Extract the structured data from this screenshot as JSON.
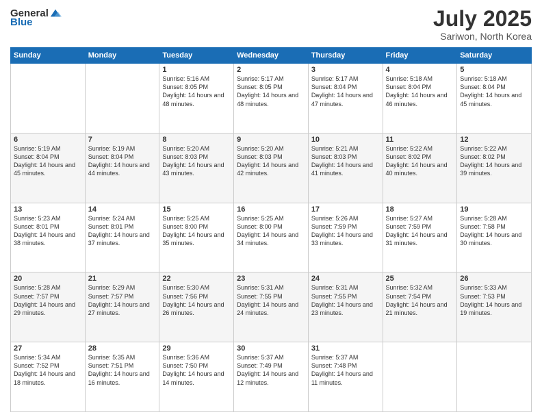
{
  "logo": {
    "general": "General",
    "blue": "Blue"
  },
  "title": "July 2025",
  "subtitle": "Sariwon, North Korea",
  "headers": [
    "Sunday",
    "Monday",
    "Tuesday",
    "Wednesday",
    "Thursday",
    "Friday",
    "Saturday"
  ],
  "weeks": [
    [
      {
        "day": "",
        "text": ""
      },
      {
        "day": "",
        "text": ""
      },
      {
        "day": "1",
        "text": "Sunrise: 5:16 AM\nSunset: 8:05 PM\nDaylight: 14 hours and 48 minutes."
      },
      {
        "day": "2",
        "text": "Sunrise: 5:17 AM\nSunset: 8:05 PM\nDaylight: 14 hours and 48 minutes."
      },
      {
        "day": "3",
        "text": "Sunrise: 5:17 AM\nSunset: 8:04 PM\nDaylight: 14 hours and 47 minutes."
      },
      {
        "day": "4",
        "text": "Sunrise: 5:18 AM\nSunset: 8:04 PM\nDaylight: 14 hours and 46 minutes."
      },
      {
        "day": "5",
        "text": "Sunrise: 5:18 AM\nSunset: 8:04 PM\nDaylight: 14 hours and 45 minutes."
      }
    ],
    [
      {
        "day": "6",
        "text": "Sunrise: 5:19 AM\nSunset: 8:04 PM\nDaylight: 14 hours and 45 minutes."
      },
      {
        "day": "7",
        "text": "Sunrise: 5:19 AM\nSunset: 8:04 PM\nDaylight: 14 hours and 44 minutes."
      },
      {
        "day": "8",
        "text": "Sunrise: 5:20 AM\nSunset: 8:03 PM\nDaylight: 14 hours and 43 minutes."
      },
      {
        "day": "9",
        "text": "Sunrise: 5:20 AM\nSunset: 8:03 PM\nDaylight: 14 hours and 42 minutes."
      },
      {
        "day": "10",
        "text": "Sunrise: 5:21 AM\nSunset: 8:03 PM\nDaylight: 14 hours and 41 minutes."
      },
      {
        "day": "11",
        "text": "Sunrise: 5:22 AM\nSunset: 8:02 PM\nDaylight: 14 hours and 40 minutes."
      },
      {
        "day": "12",
        "text": "Sunrise: 5:22 AM\nSunset: 8:02 PM\nDaylight: 14 hours and 39 minutes."
      }
    ],
    [
      {
        "day": "13",
        "text": "Sunrise: 5:23 AM\nSunset: 8:01 PM\nDaylight: 14 hours and 38 minutes."
      },
      {
        "day": "14",
        "text": "Sunrise: 5:24 AM\nSunset: 8:01 PM\nDaylight: 14 hours and 37 minutes."
      },
      {
        "day": "15",
        "text": "Sunrise: 5:25 AM\nSunset: 8:00 PM\nDaylight: 14 hours and 35 minutes."
      },
      {
        "day": "16",
        "text": "Sunrise: 5:25 AM\nSunset: 8:00 PM\nDaylight: 14 hours and 34 minutes."
      },
      {
        "day": "17",
        "text": "Sunrise: 5:26 AM\nSunset: 7:59 PM\nDaylight: 14 hours and 33 minutes."
      },
      {
        "day": "18",
        "text": "Sunrise: 5:27 AM\nSunset: 7:59 PM\nDaylight: 14 hours and 31 minutes."
      },
      {
        "day": "19",
        "text": "Sunrise: 5:28 AM\nSunset: 7:58 PM\nDaylight: 14 hours and 30 minutes."
      }
    ],
    [
      {
        "day": "20",
        "text": "Sunrise: 5:28 AM\nSunset: 7:57 PM\nDaylight: 14 hours and 29 minutes."
      },
      {
        "day": "21",
        "text": "Sunrise: 5:29 AM\nSunset: 7:57 PM\nDaylight: 14 hours and 27 minutes."
      },
      {
        "day": "22",
        "text": "Sunrise: 5:30 AM\nSunset: 7:56 PM\nDaylight: 14 hours and 26 minutes."
      },
      {
        "day": "23",
        "text": "Sunrise: 5:31 AM\nSunset: 7:55 PM\nDaylight: 14 hours and 24 minutes."
      },
      {
        "day": "24",
        "text": "Sunrise: 5:31 AM\nSunset: 7:55 PM\nDaylight: 14 hours and 23 minutes."
      },
      {
        "day": "25",
        "text": "Sunrise: 5:32 AM\nSunset: 7:54 PM\nDaylight: 14 hours and 21 minutes."
      },
      {
        "day": "26",
        "text": "Sunrise: 5:33 AM\nSunset: 7:53 PM\nDaylight: 14 hours and 19 minutes."
      }
    ],
    [
      {
        "day": "27",
        "text": "Sunrise: 5:34 AM\nSunset: 7:52 PM\nDaylight: 14 hours and 18 minutes."
      },
      {
        "day": "28",
        "text": "Sunrise: 5:35 AM\nSunset: 7:51 PM\nDaylight: 14 hours and 16 minutes."
      },
      {
        "day": "29",
        "text": "Sunrise: 5:36 AM\nSunset: 7:50 PM\nDaylight: 14 hours and 14 minutes."
      },
      {
        "day": "30",
        "text": "Sunrise: 5:37 AM\nSunset: 7:49 PM\nDaylight: 14 hours and 12 minutes."
      },
      {
        "day": "31",
        "text": "Sunrise: 5:37 AM\nSunset: 7:48 PM\nDaylight: 14 hours and 11 minutes."
      },
      {
        "day": "",
        "text": ""
      },
      {
        "day": "",
        "text": ""
      }
    ]
  ]
}
